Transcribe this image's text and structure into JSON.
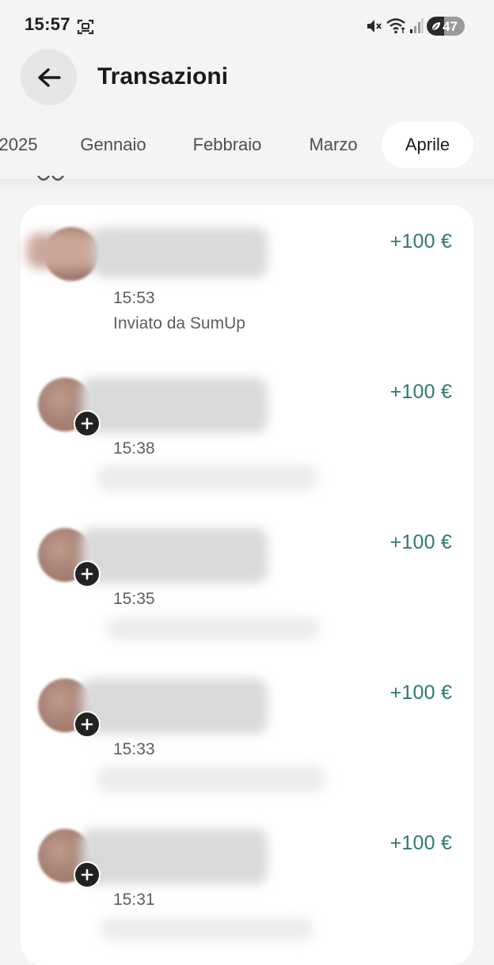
{
  "status_bar": {
    "time": "15:57",
    "battery_level": "47",
    "icons": [
      "screenshot-icon",
      "mute-icon",
      "wifi-icon",
      "signal-icon",
      "battery-icon"
    ]
  },
  "header": {
    "back_icon": "arrow-left-icon",
    "title": "Transazioni"
  },
  "month_tabs": [
    {
      "label": "2025",
      "active": false
    },
    {
      "label": "Gennaio",
      "active": false
    },
    {
      "label": "Febbraio",
      "active": false
    },
    {
      "label": "Marzo",
      "active": false
    },
    {
      "label": "Aprile",
      "active": true
    }
  ],
  "transactions": [
    {
      "amount": "+100 €",
      "time": "15:53",
      "note": "Inviato da SumUp",
      "badge": false
    },
    {
      "amount": "+100 €",
      "time": "15:38",
      "note": "",
      "badge": true
    },
    {
      "amount": "+100 €",
      "time": "15:35",
      "note": "",
      "badge": true
    },
    {
      "amount": "+100 €",
      "time": "15:33",
      "note": "",
      "badge": true
    },
    {
      "amount": "+100 €",
      "time": "15:31",
      "note": "",
      "badge": true
    }
  ],
  "colors": {
    "background": "#f4f4f4",
    "card": "#ffffff",
    "amount_positive": "#2e7d5b",
    "active_tab": "#ffffff"
  }
}
